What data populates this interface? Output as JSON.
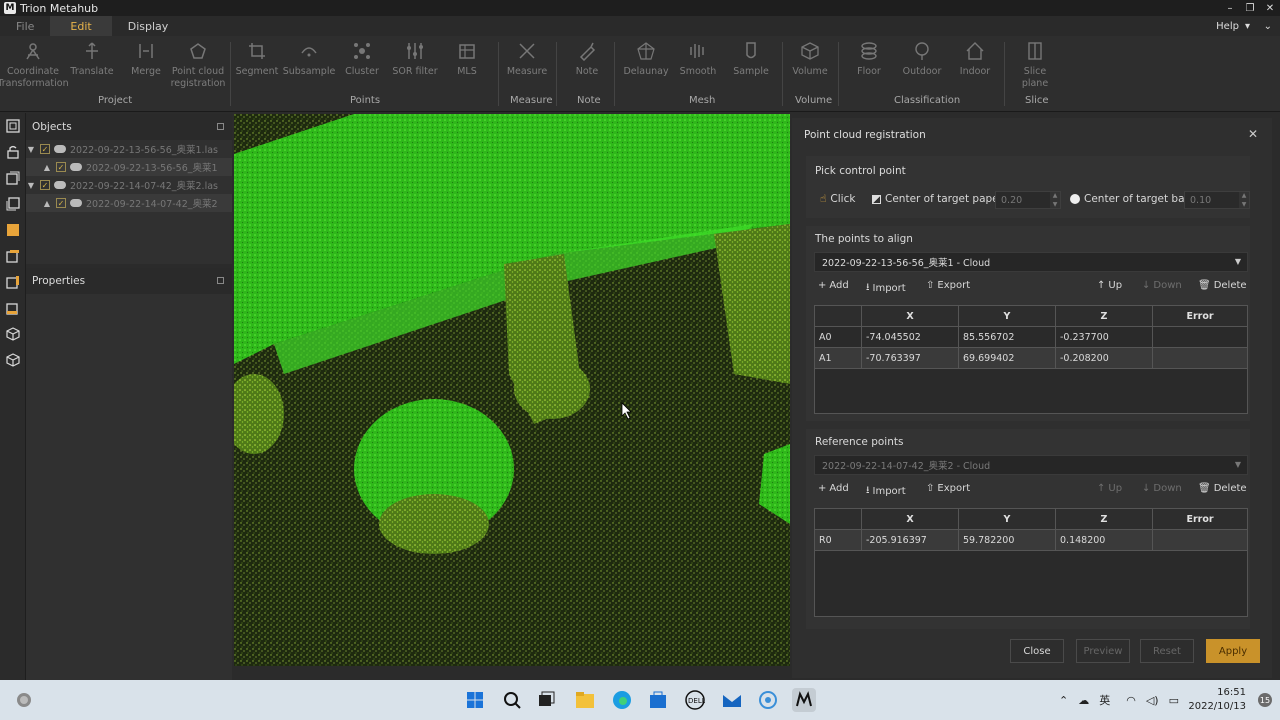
{
  "window": {
    "title": "Trion Metahub",
    "minimize": "–",
    "restore": "❐",
    "close": "✕"
  },
  "menu": {
    "file": "File",
    "edit": "Edit",
    "display": "Display",
    "help": "Help",
    "help_arrow": "▾",
    "chevron": "⌄"
  },
  "ribbon": {
    "buttons": [
      {
        "label": "Coordinate\nTransformation",
        "icon": "coordinate-icon"
      },
      {
        "label": "Translate",
        "icon": "translate-icon"
      },
      {
        "label": "Merge",
        "icon": "merge-icon"
      },
      {
        "label": "Point cloud\nregistration",
        "icon": "registration-icon"
      },
      {
        "label": "Segment",
        "icon": "segment-icon"
      },
      {
        "label": "Subsample",
        "icon": "subsample-icon"
      },
      {
        "label": "Cluster",
        "icon": "cluster-icon"
      },
      {
        "label": "SOR filter",
        "icon": "sor-filter-icon"
      },
      {
        "label": "MLS",
        "icon": "mls-icon"
      },
      {
        "label": "Measure",
        "icon": "measure-icon"
      },
      {
        "label": "Note",
        "icon": "note-icon"
      },
      {
        "label": "Delaunay",
        "icon": "delaunay-icon"
      },
      {
        "label": "Smooth",
        "icon": "smooth-icon"
      },
      {
        "label": "Sample",
        "icon": "sample-icon"
      },
      {
        "label": "Volume",
        "icon": "volume-icon"
      },
      {
        "label": "Floor",
        "icon": "floor-icon"
      },
      {
        "label": "Outdoor",
        "icon": "outdoor-icon"
      },
      {
        "label": "Indoor",
        "icon": "indoor-icon"
      },
      {
        "label": "Slice plane",
        "icon": "slice-plane-icon"
      }
    ],
    "groups": [
      "Project",
      "Points",
      "Measure",
      "Note",
      "Mesh",
      "Volume",
      "Classification",
      "Slice"
    ]
  },
  "objects_panel": {
    "title": "Objects",
    "items": [
      {
        "label": "2022-09-22-13-56-56_奥莱1.las"
      },
      {
        "label": "2022-09-22-13-56-56_奥莱1"
      },
      {
        "label": "2022-09-22-14-07-42_奥莱2.las"
      },
      {
        "label": "2022-09-22-14-07-42_奥莱2"
      }
    ],
    "expand_arrow": "▼",
    "child_arrow": "▲",
    "check": "✓"
  },
  "properties_panel": {
    "title": "Properties"
  },
  "dialog": {
    "title": "Point cloud registration",
    "close": "✕",
    "pick_control_point": "Pick control point",
    "click_label": "Click",
    "center_target_paper": "Center of target paper",
    "paper_value": "0.20",
    "center_target_ball": "Center of target ball",
    "ball_value": "0.10",
    "points_to_align_label": "The points to align",
    "points_to_align_selected": "2022-09-22-13-56-56_奥莱1 - Cloud",
    "reference_points_label": "Reference points",
    "reference_selected": "2022-09-22-14-07-42_奥莱2 - Cloud",
    "toolbar": {
      "add": "Add",
      "import": "Import",
      "export": "Export",
      "up": "Up",
      "down": "Down",
      "delete": "Delete"
    },
    "columns": [
      "",
      "X",
      "Y",
      "Z",
      "Error"
    ],
    "align_rows": [
      {
        "name": "A0",
        "x": "-74.045502",
        "y": "85.556702",
        "z": "-0.237700",
        "error": ""
      },
      {
        "name": "A1",
        "x": "-70.763397",
        "y": "69.699402",
        "z": "-0.208200",
        "error": ""
      }
    ],
    "reference_rows": [
      {
        "name": "R0",
        "x": "-205.916397",
        "y": "59.782200",
        "z": "0.148200",
        "error": ""
      }
    ],
    "buttons": {
      "close": "Close",
      "preview": "Preview",
      "reset": "Reset",
      "apply": "Apply"
    }
  },
  "taskbar": {
    "ime": "英",
    "time": "16:51",
    "date": "2022/10/13",
    "notifications": "15"
  },
  "colors": {
    "accent": "#c9922a",
    "active_tab": "#e7b34a",
    "point_cloud": "#39d11f"
  }
}
